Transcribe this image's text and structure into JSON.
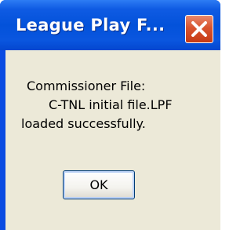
{
  "window": {
    "title": "League Play F...",
    "close_icon": "close-x-icon"
  },
  "message": {
    "line1": "Commissioner File:",
    "line2": "C-TNL initial file.LPF",
    "line3": "loaded successfully."
  },
  "buttons": {
    "ok_label": "OK"
  },
  "colors": {
    "title_bar": "#0a4be2",
    "client_bg": "#ece9d8",
    "close_button": "#d8542f"
  }
}
